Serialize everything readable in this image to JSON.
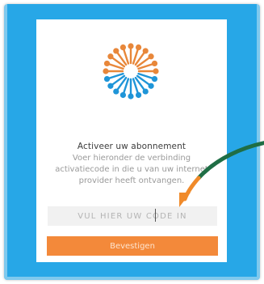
{
  "dialog": {
    "title": "Activeer uw abonnement",
    "description": "Voer hieronder de verbinding activatiecode in die u van uw internet provider heeft ontvangen.",
    "code_input": {
      "placeholder": "VUL HIER UW CODE IN",
      "value": ""
    },
    "confirm_label": "Bevestigen"
  },
  "icons": {
    "logo": "sun-burst-logo-icon",
    "pointer": "curved-arrow-icon"
  },
  "colors": {
    "background": "#27a7e7",
    "accent_orange": "#f3893a",
    "accent_blue": "#1f95d8",
    "arrow_green": "#1f6e45"
  }
}
